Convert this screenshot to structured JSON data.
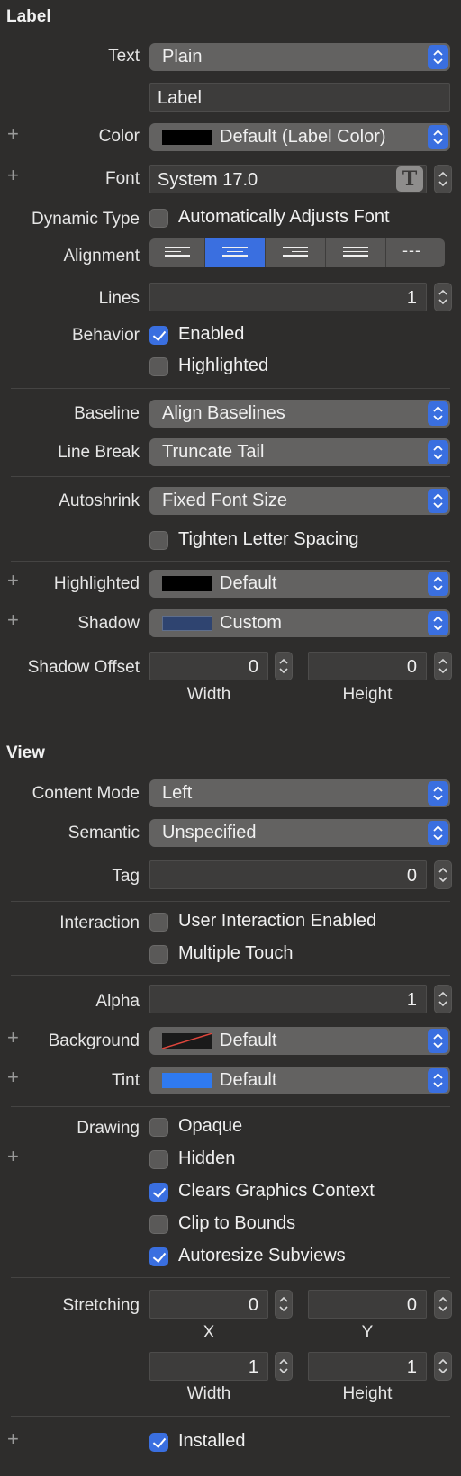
{
  "label_section": {
    "title": "Label",
    "text": {
      "label": "Text",
      "value": "Plain"
    },
    "text_field": {
      "value": "Label"
    },
    "color": {
      "label": "Color",
      "value": "Default (Label Color)"
    },
    "font": {
      "label": "Font",
      "value": "System 17.0"
    },
    "dynamic_type": {
      "label": "Dynamic Type",
      "option": "Automatically Adjusts Font",
      "checked": false
    },
    "alignment": {
      "label": "Alignment",
      "selected_index": 1,
      "natural_label": "---"
    },
    "lines": {
      "label": "Lines",
      "value": "1"
    },
    "behavior": {
      "label": "Behavior",
      "enabled": "Enabled",
      "highlighted": "Highlighted"
    },
    "baseline": {
      "label": "Baseline",
      "value": "Align Baselines"
    },
    "line_break": {
      "label": "Line Break",
      "value": "Truncate Tail"
    },
    "autoshrink": {
      "label": "Autoshrink",
      "value": "Fixed Font Size",
      "tighten": "Tighten Letter Spacing"
    },
    "highlighted_color": {
      "label": "Highlighted",
      "value": "Default"
    },
    "shadow": {
      "label": "Shadow",
      "value": "Custom",
      "swatch": "#2f4470"
    },
    "shadow_offset": {
      "label": "Shadow Offset",
      "width": "0",
      "height": "0",
      "width_label": "Width",
      "height_label": "Height"
    }
  },
  "view_section": {
    "title": "View",
    "content_mode": {
      "label": "Content Mode",
      "value": "Left"
    },
    "semantic": {
      "label": "Semantic",
      "value": "Unspecified"
    },
    "tag": {
      "label": "Tag",
      "value": "0"
    },
    "interaction": {
      "label": "Interaction",
      "user_interaction": "User Interaction Enabled",
      "multiple_touch": "Multiple Touch"
    },
    "alpha": {
      "label": "Alpha",
      "value": "1"
    },
    "background": {
      "label": "Background",
      "value": "Default"
    },
    "tint": {
      "label": "Tint",
      "value": "Default",
      "swatch": "#2f7af0"
    },
    "drawing": {
      "label": "Drawing",
      "opaque": "Opaque",
      "hidden": "Hidden",
      "clears": "Clears Graphics Context",
      "clip": "Clip to Bounds",
      "autoresize": "Autoresize Subviews"
    },
    "stretching": {
      "label": "Stretching",
      "x": "0",
      "y": "0",
      "width": "1",
      "height": "1",
      "x_label": "X",
      "y_label": "Y",
      "width_label": "Width",
      "height_label": "Height"
    },
    "installed": {
      "label": "Installed"
    }
  },
  "colors": {
    "accent": "#3a6fe0",
    "background": "#2e2d2c",
    "control": "#636261"
  },
  "plus_symbol": "+"
}
